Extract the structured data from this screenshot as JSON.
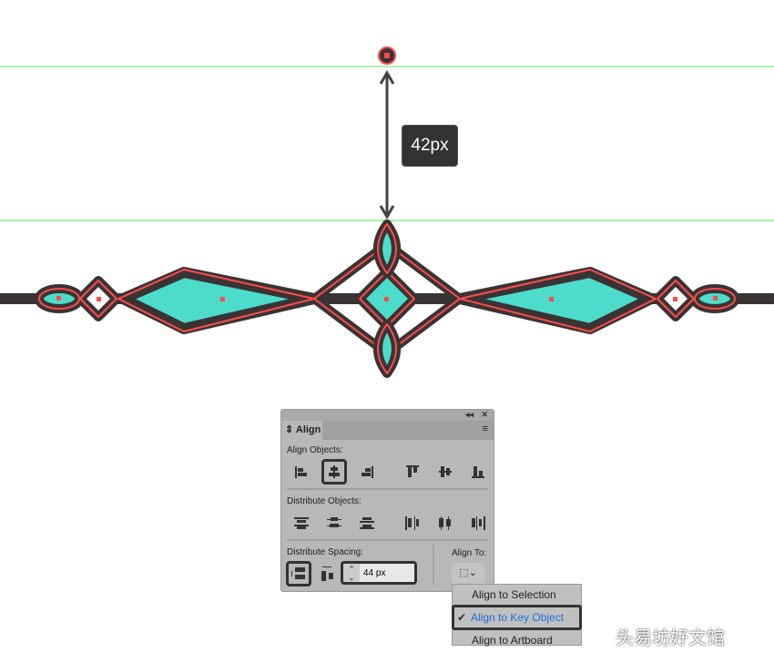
{
  "canvas": {
    "measure_label": "42px",
    "colors": {
      "stroke": "#3a3334",
      "selection": "#ff4b4b",
      "fill": "#4ddccb",
      "guide": "#55ee55"
    }
  },
  "panel": {
    "title": "Align",
    "collapse_icon": "double-chevron-left-icon",
    "close_icon": "close-icon",
    "menu_icon": "menu-icon",
    "align_objects_label": "Align Objects:",
    "distribute_objects_label": "Distribute Objects:",
    "distribute_spacing_label": "Distribute Spacing:",
    "align_to_label": "Align To:",
    "spacing_value": "44 px",
    "selected_align": "horizontal-align-center"
  },
  "dropdown": {
    "items": [
      {
        "label": "Align to Selection",
        "checked": false
      },
      {
        "label": "Align to Key Object",
        "checked": true
      },
      {
        "label": "Align to Artboard",
        "checked": false
      }
    ],
    "check": "✔"
  },
  "watermark": "头易坊好文馆"
}
